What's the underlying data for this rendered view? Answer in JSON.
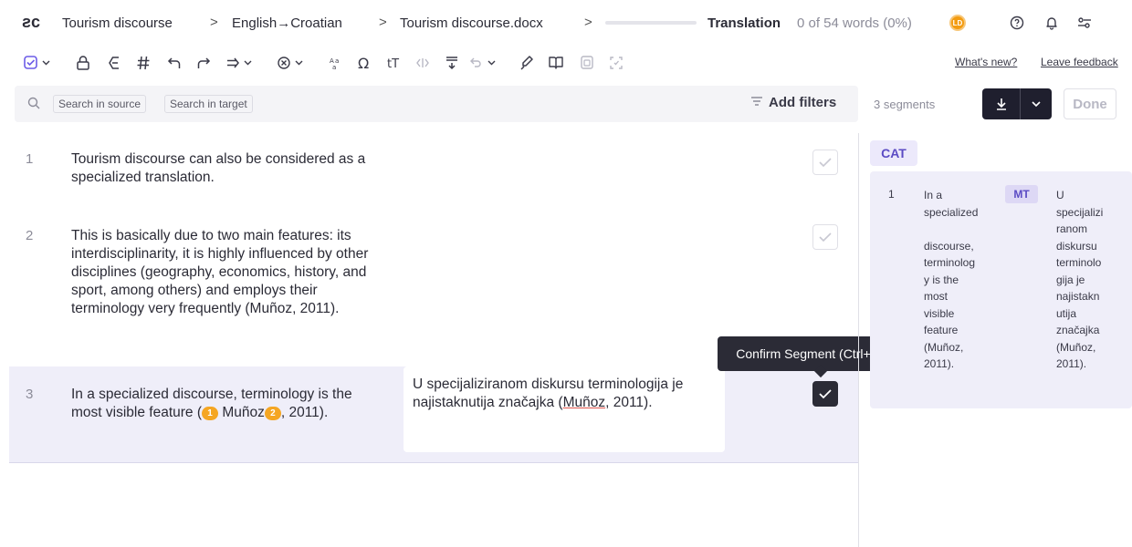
{
  "header": {
    "logo_glyph": "ƨc",
    "breadcrumb": [
      "Tourism discourse",
      "English→Croatian",
      "Tourism discourse.docx"
    ],
    "separator": ">",
    "progress_percent": 0,
    "translation_label": "Translation",
    "word_count": "0 of 54 words (0%)",
    "avatar_initials": "LD"
  },
  "toolbar": {
    "whats_new": "What's new?",
    "feedback": "Leave feedback"
  },
  "search": {
    "chip_source": "Search in source",
    "chip_target": "Search in target",
    "filters_label": "Add filters",
    "segments_count": "3 segments",
    "done_label": "Done"
  },
  "segments": [
    {
      "num": "1",
      "source": "Tourism discourse can also be considered as a specialized translation.",
      "target": ""
    },
    {
      "num": "2",
      "source": "This is basically due to two main features: its interdisciplinarity, it is highly influenced by other disciplines (geography, economics, history, and sport, among others) and employs their terminology very frequently (Muñoz, 2011).",
      "target": ""
    },
    {
      "num": "3",
      "source_before": "In a specialized discourse, terminology is the most visible feature (",
      "tag1": "1",
      "source_mid": "Muñoz",
      "tag2": "2",
      "source_after": ", 2011).",
      "target_before": "U specijaliziranom diskursu terminologija je najistaknutija značajka (",
      "target_err": "Muñoz",
      "target_after": ", 2011)."
    }
  ],
  "tooltip": "Confirm Segment (Ctrl+Enter)",
  "cat_panel": {
    "tab_label": "CAT",
    "match": {
      "num": "1",
      "source_lines": [
        "In a",
        "specialized",
        "",
        "discourse,",
        "terminolog",
        "y is the",
        "most",
        "visible",
        "feature",
        "(Muñoz,",
        "2011)."
      ],
      "badge": "MT",
      "target_lines": [
        "U",
        "specijalizi",
        "ranom",
        "diskursu",
        "terminolo",
        "gija je",
        "najistakn",
        "utija",
        "značajka",
        "(Muñoz,",
        "2011)."
      ]
    }
  }
}
